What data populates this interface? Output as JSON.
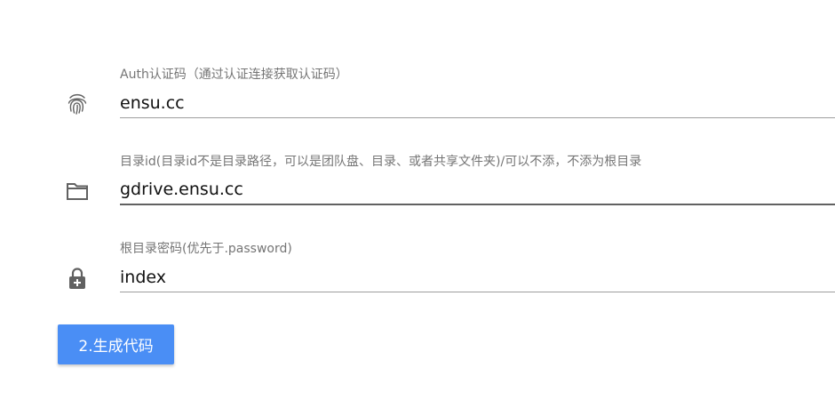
{
  "fields": [
    {
      "label": "Auth认证码（通过认证连接获取认证码）",
      "value": "ensu.cc",
      "icon": "fingerprint-icon"
    },
    {
      "label": "目录id(目录id不是目录路径，可以是团队盘、目录、或者共享文件夹)/可以不添，不添为根目录",
      "value": "gdrive.ensu.cc",
      "icon": "folder-icon"
    },
    {
      "label": "根目录密码(优先于.password)",
      "value": "index",
      "icon": "lock-add-icon"
    }
  ],
  "generate_button": {
    "label": "2.生成代码",
    "color": "#4a8ef5"
  },
  "colors": {
    "label": "#757575",
    "underline": "#9e9e9e",
    "icon": "#616161"
  }
}
